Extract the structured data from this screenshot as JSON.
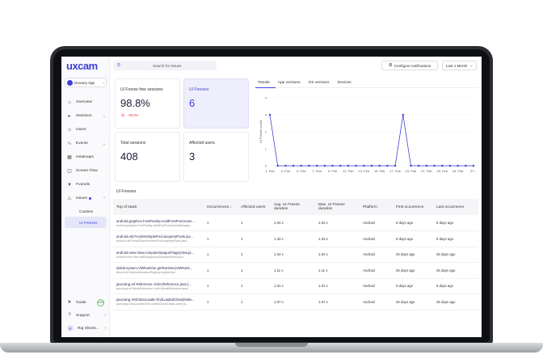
{
  "brand": {
    "logo_text": "uxcam",
    "accent": "#3f3fd6"
  },
  "app_selector": {
    "value": "Grocery App"
  },
  "sidebar": {
    "items": [
      {
        "label": "Overview",
        "icon": "home-icon"
      },
      {
        "label": "Sessions",
        "icon": "play-icon"
      },
      {
        "label": "Users",
        "icon": "users-icon"
      },
      {
        "label": "Events",
        "icon": "events-icon"
      },
      {
        "label": "Heatmaps",
        "icon": "heatmap-icon"
      },
      {
        "label": "Screen Flow",
        "icon": "flow-icon"
      },
      {
        "label": "Funnels",
        "icon": "funnel-icon"
      },
      {
        "label": "Issues",
        "icon": "issues-icon"
      }
    ],
    "sub_items": [
      {
        "label": "Crashes"
      },
      {
        "label": "UI Freezes"
      }
    ],
    "bottom": {
      "guide": "Guide",
      "guide_progress": "33%",
      "support": "Support",
      "user": "Raj Shrest...",
      "avatar": "R"
    }
  },
  "topbar": {
    "search_placeholder": "Search for issues",
    "notifications_label": "Configure notifications",
    "date_range": "Last 1 Month"
  },
  "cards": [
    {
      "label": "UI Freeze free sessions",
      "value": "98.8%",
      "change": "-98.8%"
    },
    {
      "label": "UI Freezes",
      "value": "6"
    },
    {
      "label": "Total sessions",
      "value": "408"
    },
    {
      "label": "Affected users",
      "value": "3"
    }
  ],
  "trends": {
    "tabs": [
      "Trends",
      "App versions",
      "OS versions",
      "Devices"
    ]
  },
  "chart_data": {
    "type": "line",
    "ylabel": "UI Freeze count",
    "ylim": [
      0,
      4
    ],
    "yticks": [
      "0",
      "1",
      "2",
      "3",
      "4"
    ],
    "x": [
      "1. Feb",
      "2. Feb",
      "3. Feb",
      "4. Feb",
      "5. Feb",
      "6. Feb",
      "7. Feb",
      "8. Feb",
      "9. Feb",
      "10. Feb",
      "11. Feb",
      "12. Feb",
      "13. Feb",
      "14. Feb",
      "15. Feb",
      "16. Feb",
      "17. Feb",
      "18. Feb",
      "19. Feb",
      "20. Feb",
      "21. Feb",
      "22. Feb",
      "23. Feb",
      "24. Feb",
      "25. Feb",
      "26. Feb",
      "27. Feb"
    ],
    "xtick_labels": [
      "1. Feb",
      "3. Feb",
      "5. Feb",
      "7. Feb",
      "9. Feb",
      "11. Feb",
      "13. Feb",
      "15. Feb",
      "17. Feb",
      "19. Feb",
      "21. Feb",
      "23. Feb",
      "25. Feb",
      "27..."
    ],
    "series": [
      {
        "values": [
          3,
          0,
          0,
          0,
          0,
          0,
          0,
          0,
          0,
          0,
          0,
          0,
          0,
          0,
          0,
          0,
          0,
          3,
          0,
          0,
          0,
          0,
          0,
          0,
          0,
          0,
          0
        ]
      }
    ],
    "color": "#3f3fd6"
  },
  "table": {
    "title": "UI Freezes",
    "headers": [
      "Top of stack",
      "Occurrences ↓",
      "Affected users",
      "Avg. UI Freeze duration",
      "Max. UI Freeze duration",
      "Platform",
      "First occurrence",
      "Last occurrence"
    ],
    "rows": [
      {
        "stack": "android.graphics.FontFamily.nAddFontFromAsse...",
        "sub": "android.graphics.FontFamily.nAddFontFromAssetManager...",
        "occ": "1",
        "users": "1",
        "avg": "1.04 s",
        "max": "1.04 s",
        "platform": "Android",
        "first": "9 days ago",
        "last": "9 days ago"
      },
      {
        "stack": "android.util.PoolsSSimplePool.acquire(Pools.jav...",
        "sub": "android.util.PoolsSSynchronizedPool.acquire(Pools.java...",
        "occ": "1",
        "users": "1",
        "avg": "1.33 s",
        "max": "1.33 s",
        "platform": "Android",
        "first": "9 days ago",
        "last": "9 days ago"
      },
      {
        "stack": "android.view.View.computeOpaqueFlags(View.ja...",
        "sub": "android.view.View.setBackgroundDrawable(View.java...",
        "occ": "1",
        "users": "1",
        "avg": "1.04 s",
        "max": "1.04 s",
        "platform": "Android",
        "first": "25 days ago",
        "last": "25 days ago"
      },
      {
        "stack": "dalvik.system.VMRuntime.getRuntime(VMRunti...",
        "sub": "libcore.util.NativeAllocationRegistry.registerNat...",
        "occ": "1",
        "users": "1",
        "avg": "1.11 s",
        "max": "1.11 s",
        "platform": "Android",
        "first": "25 days ago",
        "last": "25 days ago"
      },
      {
        "stack": "java.lang.ref.Reference.<init>(Reference.java:(...",
        "sub": "java.lang.ref.WeakReference.<init>(WeakReference.java...",
        "occ": "1",
        "users": "1",
        "avg": "1.01 s",
        "max": "1.01 s",
        "platform": "Android",
        "first": "9 days ago",
        "last": "9 days ago"
      },
      {
        "stack": "java.lang.VMClassLoader.findLoadedClass(Nativ...",
        "sub": "java.lang.ClassLoader.findLoadedClass(ClassLoader.ja...",
        "occ": "1",
        "users": "1",
        "avg": "1.07 s",
        "max": "1.07 s",
        "platform": "Android",
        "first": "25 days ago",
        "last": "25 days ago"
      }
    ]
  }
}
